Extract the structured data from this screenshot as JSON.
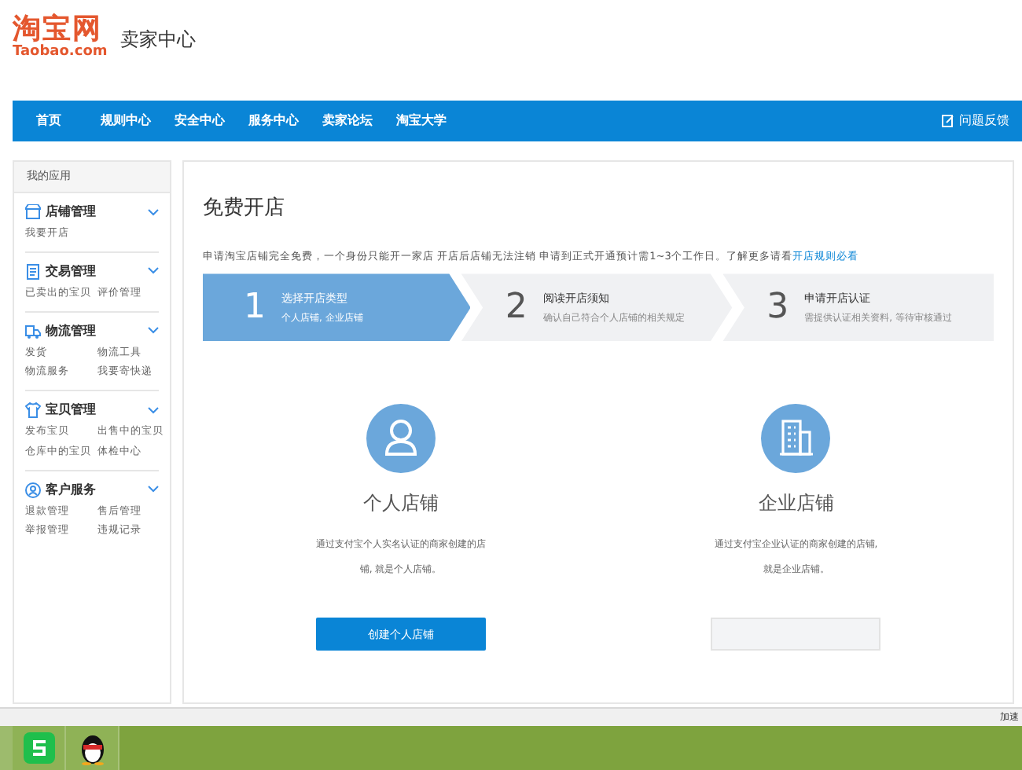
{
  "header": {
    "logo": "淘宝网",
    "logo_sub": "Taobao.com",
    "title": "卖家中心"
  },
  "nav": {
    "items": [
      "首页",
      "规则中心",
      "安全中心",
      "服务中心",
      "卖家论坛",
      "淘宝大学"
    ],
    "feedback": "问题反馈"
  },
  "sidebar": {
    "title": "我的应用",
    "groups": [
      {
        "kind": "shop",
        "title": "店铺管理",
        "expanded": true,
        "links": [
          "我要开店"
        ]
      },
      {
        "kind": "trade",
        "title": "交易管理",
        "expanded": true,
        "links": [
          "已卖出的宝贝",
          "评价管理"
        ]
      },
      {
        "kind": "logistics",
        "title": "物流管理",
        "expanded": true,
        "links": [
          "发货",
          "物流工具",
          "物流服务",
          "我要寄快递"
        ]
      },
      {
        "kind": "goods",
        "title": "宝贝管理",
        "expanded": true,
        "links": [
          "发布宝贝",
          "出售中的宝贝",
          "仓库中的宝贝",
          "体检中心"
        ]
      },
      {
        "kind": "service",
        "title": "客户服务",
        "expanded": true,
        "links": [
          "退款管理",
          "售后管理",
          "举报管理",
          "违规记录"
        ]
      }
    ]
  },
  "main": {
    "title": "免费开店",
    "notice": "申请淘宝店铺完全免费，一个身份只能开一家店 开店后店铺无法注销 申请到正式开通预计需1~3个工作日。了解更多请看",
    "notice_link": "开店规则必看",
    "steps": [
      {
        "number": "1",
        "title": "选择开店类型",
        "desc": "个人店铺, 企业店铺",
        "selected": true
      },
      {
        "number": "2",
        "title": "阅读开店须知",
        "desc": "确认自己符合个人店铺的相关规定",
        "selected": false
      },
      {
        "number": "3",
        "title": "申请开店认证",
        "desc": "需提供认证相关资料, 等待审核通过",
        "selected": false
      }
    ],
    "options": [
      {
        "kind": "person",
        "title": "个人店铺",
        "desc": "通过支付宝个人实名认证的商家创建的店铺, 就是个人店铺。",
        "button": "创建个人店铺"
      },
      {
        "kind": "company",
        "title": "企业店铺",
        "desc": "通过支付宝企业认证的商家创建的店铺, 就是企业店铺。"
      }
    ]
  },
  "status_bar": {
    "text": "加速"
  },
  "taskbar": {
    "apps": [
      {
        "kind": "wps"
      },
      {
        "kind": "qq"
      }
    ]
  }
}
